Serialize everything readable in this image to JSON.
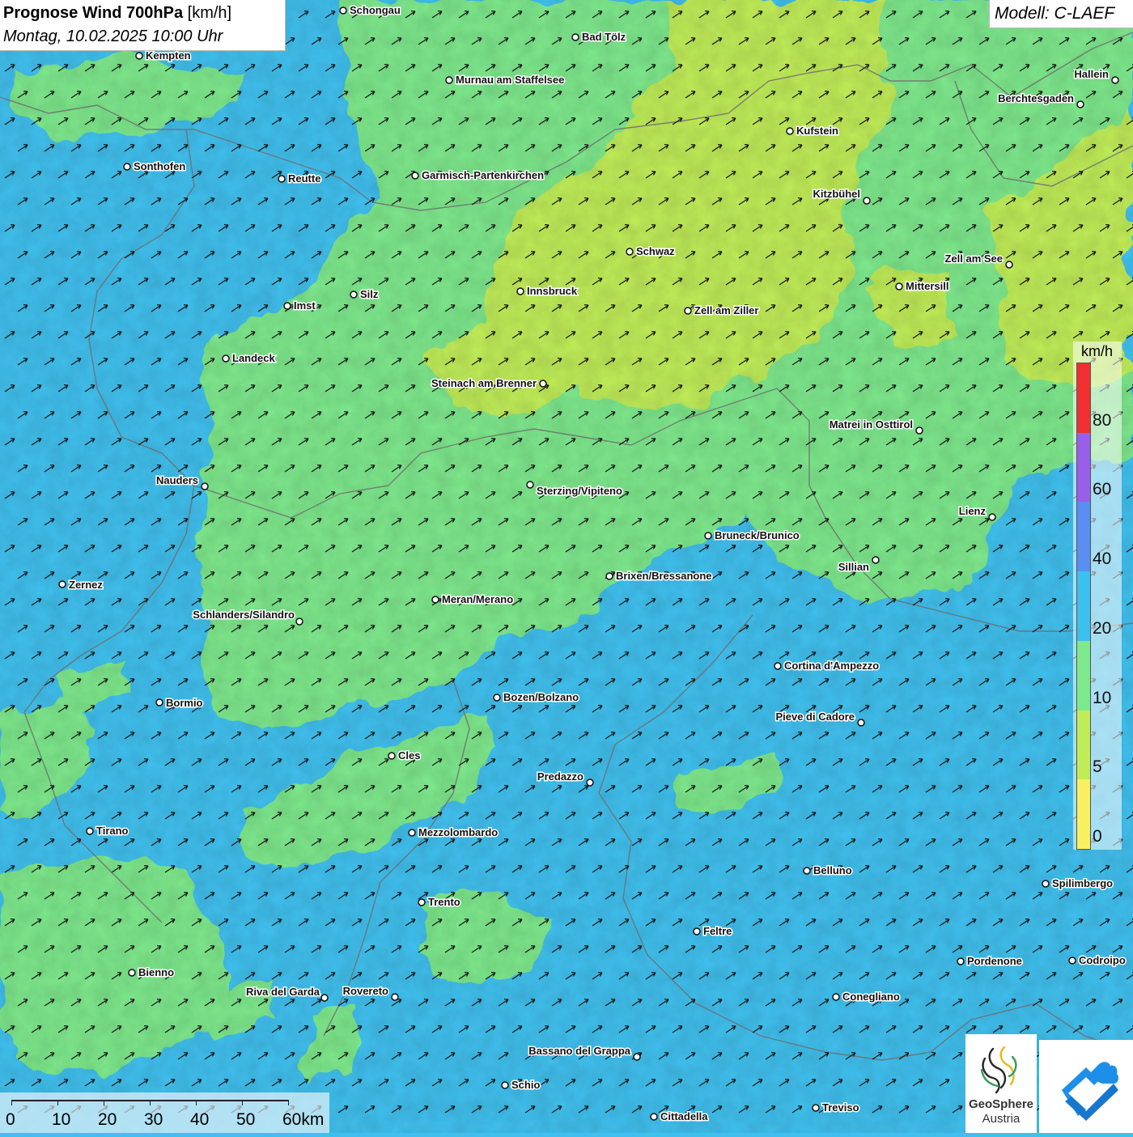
{
  "header": {
    "title": "Prognose Wind 700hPa",
    "unit": "[km/h]",
    "date": "Montag, 10.02.2025 10:00 Uhr",
    "model": "Modell: C-LAEF"
  },
  "legend": {
    "unit": "km/h",
    "ticks": [
      "80",
      "60",
      "40",
      "20",
      "10",
      "5",
      "0"
    ],
    "colors": [
      "#f03030",
      "#9a5fe8",
      "#5a8ef0",
      "#3cc0ee",
      "#7ee88c",
      "#c0ec58",
      "#f8f060"
    ],
    "thresholds_kmh": [
      80,
      60,
      40,
      20,
      10,
      5,
      0
    ]
  },
  "scale_bar": {
    "labels": [
      "0",
      "10",
      "20",
      "30",
      "40",
      "50",
      "60km"
    ]
  },
  "logo": {
    "name": "GeoSphere",
    "sub": "Austria"
  },
  "colors": {
    "wind_0_5": "#f8f060",
    "wind_5_10": "#c0ec58",
    "wind_10_20": "#7ee88c",
    "wind_20_40": "#3cc0ee",
    "border": "#6e6e6e",
    "arrow": "#1a1a1a"
  },
  "wind_arrow_direction": "south-west to north-east",
  "cities": [
    {
      "name": "Schongau"
    },
    {
      "name": "Bad Tölz"
    },
    {
      "name": "Kempten"
    },
    {
      "name": "Murnau am Staffelsee"
    },
    {
      "name": "Hallein"
    },
    {
      "name": "Berchtesgaden"
    },
    {
      "name": "Kufstein"
    },
    {
      "name": "Sonthofen"
    },
    {
      "name": "Reutte"
    },
    {
      "name": "Garmisch-Partenkirchen"
    },
    {
      "name": "Kitzbühel"
    },
    {
      "name": "Schwaz"
    },
    {
      "name": "Zell am See"
    },
    {
      "name": "Innsbruck"
    },
    {
      "name": "Mittersill"
    },
    {
      "name": "Imst"
    },
    {
      "name": "Silz"
    },
    {
      "name": "Zell am Ziller"
    },
    {
      "name": "Landeck"
    },
    {
      "name": "Steinach am Brenner"
    },
    {
      "name": "Matrei in Osttirol"
    },
    {
      "name": "Nauders"
    },
    {
      "name": "Sterzing/Vipiteno"
    },
    {
      "name": "Lienz"
    },
    {
      "name": "Bruneck/Brunico"
    },
    {
      "name": "Sillian"
    },
    {
      "name": "Brixen/Bressanone"
    },
    {
      "name": "Zernez"
    },
    {
      "name": "Meran/Merano"
    },
    {
      "name": "Schlanders/Silandro"
    },
    {
      "name": "Cortina d'Ampezzo"
    },
    {
      "name": "Bozen/Bolzano"
    },
    {
      "name": "Bormio"
    },
    {
      "name": "Pieve di Cadore"
    },
    {
      "name": "Cles"
    },
    {
      "name": "Predazzo"
    },
    {
      "name": "Tirano"
    },
    {
      "name": "Mezzolombardo"
    },
    {
      "name": "Belluno"
    },
    {
      "name": "Spilimbergo"
    },
    {
      "name": "Trento"
    },
    {
      "name": "Feltre"
    },
    {
      "name": "Bienno"
    },
    {
      "name": "Pordenone"
    },
    {
      "name": "Codroipo"
    },
    {
      "name": "Riva del Garda"
    },
    {
      "name": "Rovereto"
    },
    {
      "name": "Conegliano"
    },
    {
      "name": "Bassano del Grappa"
    },
    {
      "name": "Schio"
    },
    {
      "name": "Treviso"
    },
    {
      "name": "Cittadella"
    }
  ]
}
